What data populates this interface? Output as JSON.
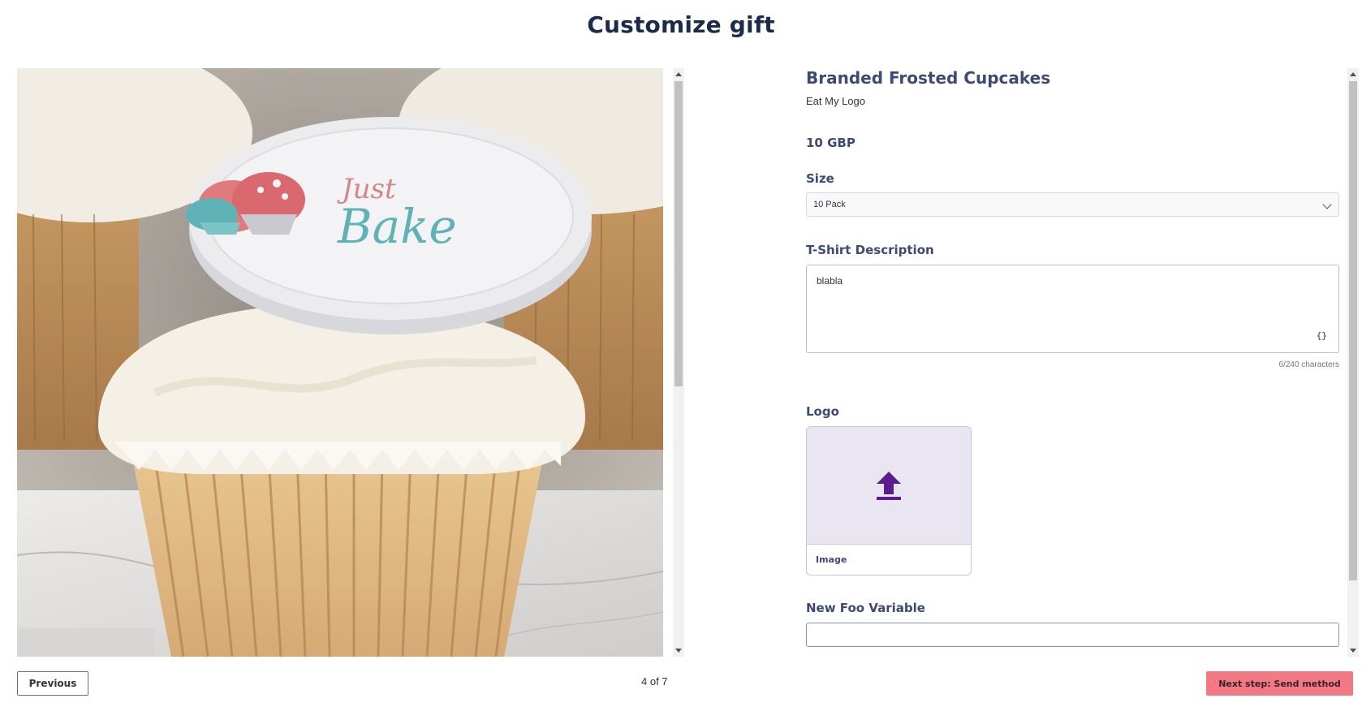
{
  "page": {
    "title": "Customize gift"
  },
  "product": {
    "name": "Branded Frosted Cupcakes",
    "vendor": "Eat My Logo",
    "price": "10 GBP",
    "image_alt": "Cupcake with Just Bake logo topper",
    "topper_text_1": "Just",
    "topper_text_2": "Bake"
  },
  "fields": {
    "size": {
      "label": "Size",
      "value": "10 Pack"
    },
    "description": {
      "label": "T-Shirt Description",
      "value": "blabla",
      "counter": "6/240 characters",
      "variable_icon": "{}"
    },
    "logo": {
      "label": "Logo",
      "caption": "Image",
      "icon": "upload-icon"
    },
    "foo": {
      "label": "New Foo Variable",
      "value": ""
    }
  },
  "footer": {
    "previous_label": "Previous",
    "pagination": "4 of 7",
    "next_label": "Next step: Send method"
  },
  "colors": {
    "accent": "#f07983",
    "upload_icon": "#5a1c8e",
    "heading": "#1c2b4a"
  }
}
